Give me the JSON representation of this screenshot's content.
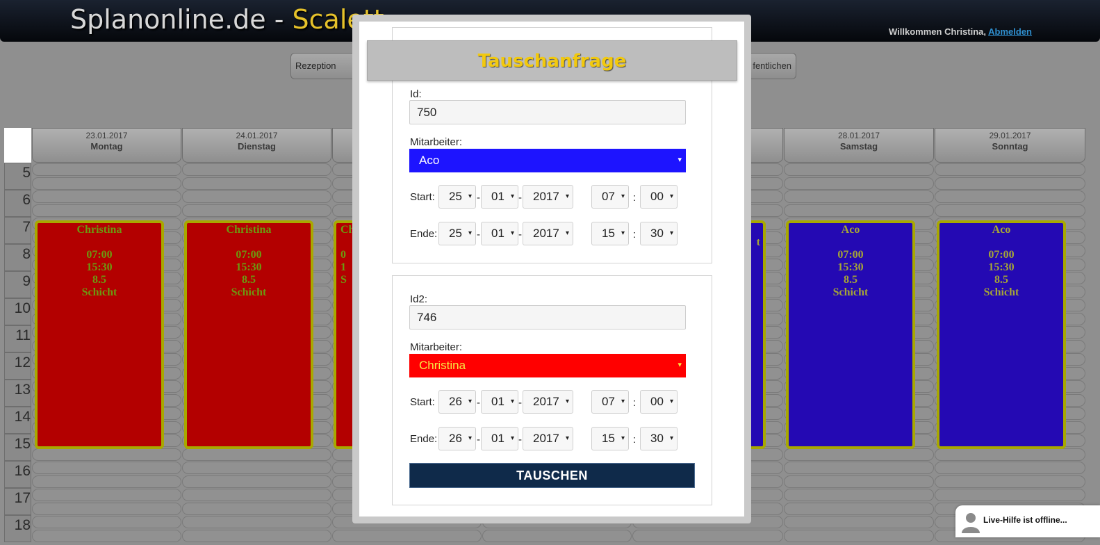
{
  "header": {
    "brand_main": "Splanonline.de - ",
    "brand_accent": "Scalett",
    "welcome_text": "Willkommen Christina, ",
    "logout_link": "Abmelden"
  },
  "nav": {
    "left_button": "Rezeption",
    "right_button": "fentlichen"
  },
  "schedule": {
    "days": [
      {
        "date": "23.01.2017",
        "name": "Montag"
      },
      {
        "date": "24.01.2017",
        "name": "Dienstag"
      },
      {
        "date": "",
        "name": ""
      },
      {
        "date": "",
        "name": ""
      },
      {
        "date": "",
        "name": ""
      },
      {
        "date": "28.01.2017",
        "name": "Samstag"
      },
      {
        "date": "29.01.2017",
        "name": "Sonntag"
      }
    ],
    "hours": [
      "5",
      "6",
      "7",
      "8",
      "9",
      "10",
      "11",
      "12",
      "13",
      "14",
      "15",
      "16",
      "17",
      "18"
    ],
    "shifts": [
      {
        "employee": "Christina",
        "start": "07:00",
        "end": "15:30",
        "hours": "8.5",
        "type": "Schicht",
        "color": "#b30000"
      },
      {
        "employee": "Christina",
        "start": "07:00",
        "end": "15:30",
        "hours": "8.5",
        "type": "Schicht",
        "color": "#b30000"
      },
      {
        "employee": "Ch",
        "start": "0",
        "end": "1",
        "hours": "",
        "type": "S",
        "color": "#b30000"
      },
      {
        "employee": "",
        "start": "",
        "end": "",
        "hours": "",
        "type": "t",
        "color": "#2409b3"
      },
      {
        "employee": "Aco",
        "start": "07:00",
        "end": "15:30",
        "hours": "8.5",
        "type": "Schicht",
        "color": "#2409b3"
      },
      {
        "employee": "Aco",
        "start": "07:00",
        "end": "15:30",
        "hours": "8.5",
        "type": "Schicht",
        "color": "#2409b3"
      }
    ]
  },
  "modal": {
    "title": "Tauschanfrage",
    "section1": {
      "id_label": "Id:",
      "id_value": "750",
      "employee_label": "Mitarbeiter:",
      "employee_value": "Aco",
      "employee_color": "#1d14ff",
      "start_label": "Start:",
      "start": {
        "day": "25",
        "month": "01",
        "year": "2017",
        "hour": "07",
        "minute": "00"
      },
      "end_label": "Ende:",
      "end": {
        "day": "25",
        "month": "01",
        "year": "2017",
        "hour": "15",
        "minute": "30"
      }
    },
    "section2": {
      "id_label": "Id2:",
      "id_value": "746",
      "employee_label": "Mitarbeiter:",
      "employee_value": "Christina",
      "employee_color": "#ff0000",
      "start_label": "Start:",
      "start": {
        "day": "26",
        "month": "01",
        "year": "2017",
        "hour": "07",
        "minute": "00"
      },
      "end_label": "Ende:",
      "end": {
        "day": "26",
        "month": "01",
        "year": "2017",
        "hour": "15",
        "minute": "30"
      }
    },
    "date_separator": "-",
    "time_separator": ":",
    "submit_label": "TAUSCHEN"
  },
  "livehelp": {
    "text": "Live-Hilfe ist offline..."
  },
  "icons": {
    "dropdown": "▾"
  }
}
